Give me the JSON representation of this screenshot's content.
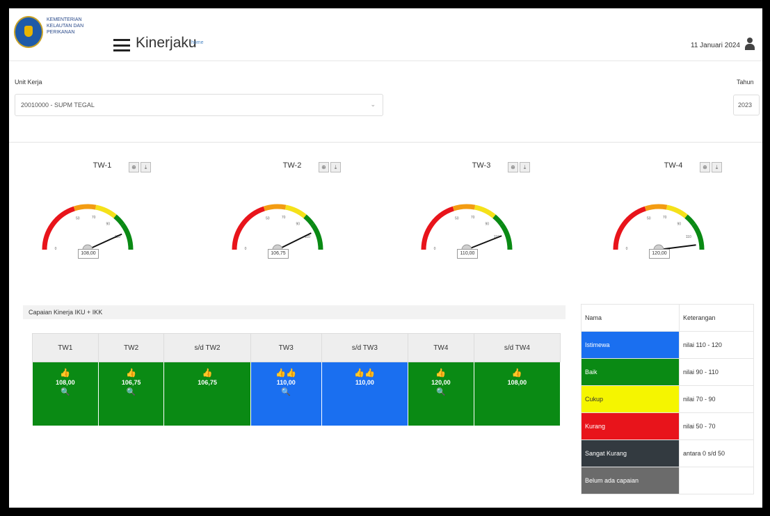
{
  "header": {
    "org_lines": [
      "KEMENTERIAN",
      "KELAUTAN DAN",
      "PERIKANAN"
    ],
    "app_title": "Kinerjaku",
    "app_sub": "home",
    "date": "11 Januari 2024",
    "logo_icon": "kkp-logo",
    "menu_icon": "hamburger-icon",
    "user_icon": "user-icon"
  },
  "filters": {
    "unit_label": "Unit Kerja",
    "unit_value": "20010000 - SUPM TEGAL",
    "year_label": "Tahun",
    "year_value": "2023"
  },
  "gauges": [
    {
      "title": "TW-1",
      "value": 108.0,
      "display": "108,00"
    },
    {
      "title": "TW-2",
      "value": 106.75,
      "display": "106,75"
    },
    {
      "title": "TW-3",
      "value": 110.0,
      "display": "110,00"
    },
    {
      "title": "TW-4",
      "value": 120.0,
      "display": "120,00"
    }
  ],
  "gauge_colors": {
    "red": "#e8141b",
    "orange": "#f39c12",
    "yellow": "#f5e11a",
    "green": "#0a8a14",
    "needle": "#111111"
  },
  "table": {
    "caption": "Capaian Kinerja IKU + IKK",
    "headers": [
      "TW1",
      "TW2",
      "s/d TW2",
      "TW3",
      "s/d TW3",
      "TW4",
      "s/d TW4"
    ],
    "cells": [
      {
        "icon": "thumbs-up",
        "icon_glyph": "👍",
        "value": "108,00",
        "color": "#0a8a14",
        "magnifier": true
      },
      {
        "icon": "thumbs-up",
        "icon_glyph": "👍",
        "value": "106,75",
        "color": "#0a8a14",
        "magnifier": true
      },
      {
        "icon": "thumbs-up",
        "icon_glyph": "👍",
        "value": "106,75",
        "color": "#0a8a14",
        "magnifier": false
      },
      {
        "icon": "double-thumbs-up",
        "icon_glyph": "👍👍",
        "value": "110,00",
        "color": "#1a6ff0",
        "magnifier": true
      },
      {
        "icon": "double-thumbs-up",
        "icon_glyph": "👍👍",
        "value": "110,00",
        "color": "#1a6ff0",
        "magnifier": false
      },
      {
        "icon": "thumbs-up",
        "icon_glyph": "👍",
        "value": "120,00",
        "color": "#0a8a14",
        "magnifier": true
      },
      {
        "icon": "thumbs-up",
        "icon_glyph": "👍",
        "value": "108,00",
        "color": "#0a8a14",
        "magnifier": false
      }
    ]
  },
  "legend": {
    "header_name": "Nama",
    "header_desc": "Keterangan",
    "rows": [
      {
        "name": "Istimewa",
        "desc": "nilai 110 - 120",
        "color": "#1a6ff0"
      },
      {
        "name": "Baik",
        "desc": "nilai 90 - 110",
        "color": "#0a8a14"
      },
      {
        "name": "Cukup",
        "desc": "nilai 70 - 90",
        "color": "#f5f500"
      },
      {
        "name": "Kurang",
        "desc": "nilai 50 - 70",
        "color": "#e8141b"
      },
      {
        "name": "Sangat Kurang",
        "desc": "antara 0 s/d 50",
        "color": "#333a40"
      },
      {
        "name": "Belum ada capaian",
        "desc": "",
        "color": "#6b6b6b"
      }
    ]
  }
}
